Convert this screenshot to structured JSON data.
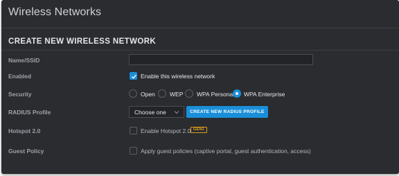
{
  "page": {
    "title": "Wireless Networks"
  },
  "section": {
    "title": "CREATE NEW WIRELESS NETWORK"
  },
  "form": {
    "name_ssid": {
      "label": "Name/SSID",
      "value": ""
    },
    "enabled": {
      "label": "Enabled",
      "checkbox_label": "Enable this wireless network",
      "checked": true
    },
    "security": {
      "label": "Security",
      "options": [
        "Open",
        "WEP",
        "WPA Personal",
        "WPA Enterprise"
      ],
      "selected": "WPA Enterprise"
    },
    "radius_profile": {
      "label": "RADIUS Profile",
      "selected": "Choose one",
      "create_button": "CREATE NEW RADIUS PROFILE"
    },
    "hotspot": {
      "label": "Hotspot 2.0",
      "checkbox_label": "Enable Hotspot 2.0",
      "badge": "GEN2",
      "checked": false
    },
    "guest_policy": {
      "label": "Guest Policy",
      "checkbox_label": "Apply guest policies (captive portal, guest authentication, access)",
      "checked": false
    }
  },
  "colors": {
    "accent": "#1a8fd9",
    "panel": "#2a2c30",
    "badge": "#e2a21a"
  }
}
